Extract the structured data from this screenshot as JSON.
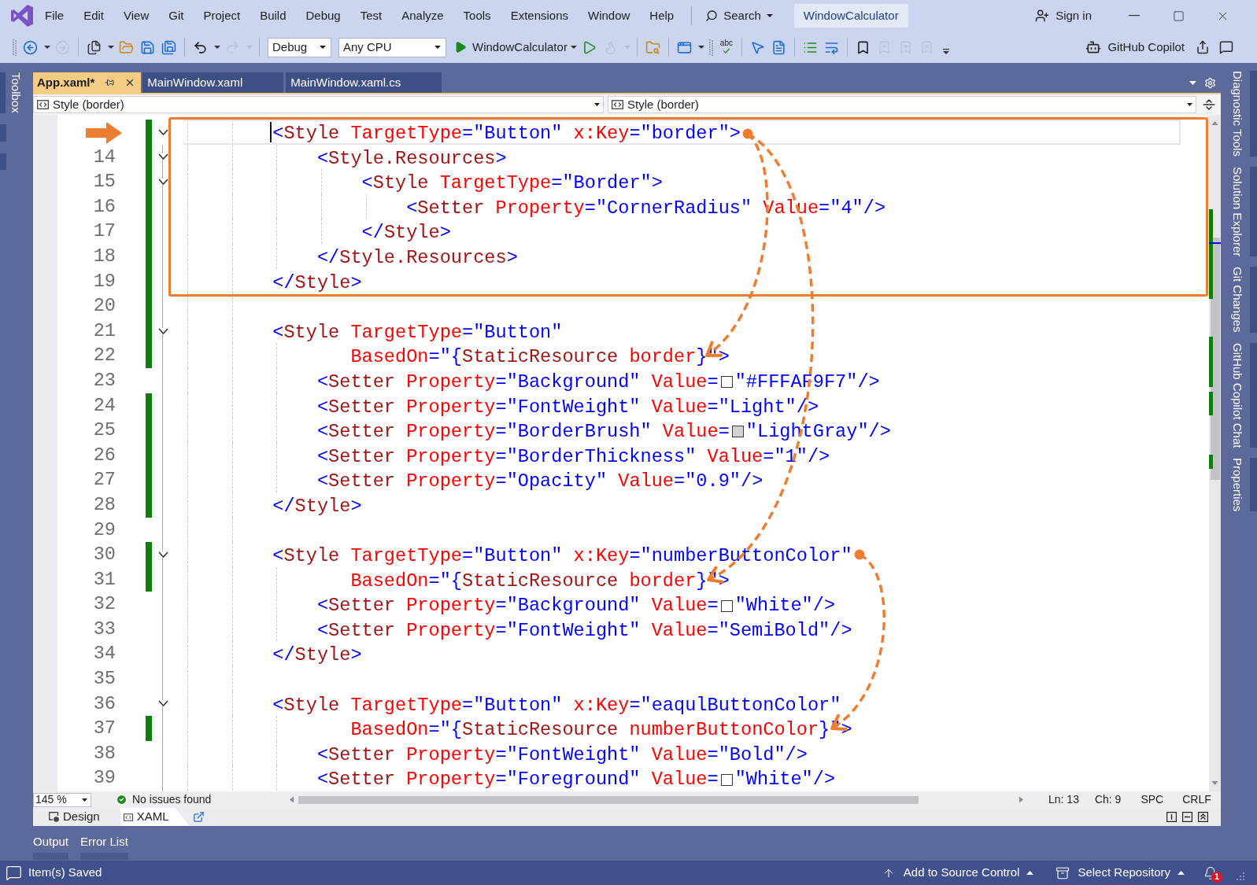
{
  "window": {
    "title": "WindowCalculator"
  },
  "menu": [
    "File",
    "Edit",
    "View",
    "Git",
    "Project",
    "Build",
    "Debug",
    "Test",
    "Analyze",
    "Tools",
    "Extensions",
    "Window",
    "Help"
  ],
  "search": {
    "label": "Search"
  },
  "account": {
    "label": "Sign in"
  },
  "toolbar": {
    "items": [
      {
        "kind": "grip"
      },
      {
        "kind": "back",
        "disabled": false,
        "menu": true
      },
      {
        "kind": "forward",
        "disabled": true
      },
      {
        "kind": "separator"
      },
      {
        "kind": "new_item",
        "disabled": false,
        "menu": true
      },
      {
        "kind": "open",
        "disabled": false
      },
      {
        "kind": "save",
        "disabled": false
      },
      {
        "kind": "save_all",
        "disabled": false
      },
      {
        "kind": "separator"
      },
      {
        "kind": "undo",
        "disabled": false,
        "menu": true
      },
      {
        "kind": "redo",
        "disabled": true,
        "menu": true
      },
      {
        "kind": "separator"
      },
      {
        "kind": "configuration",
        "value": "Debug"
      },
      {
        "kind": "platform",
        "value": "Any CPU"
      },
      {
        "kind": "start",
        "label": "WindowCalculator",
        "menu": true
      },
      {
        "kind": "start_without_debugging",
        "disabled": false
      },
      {
        "kind": "hot_reload",
        "disabled": true,
        "menu": true
      },
      {
        "kind": "separator"
      },
      {
        "kind": "find_in_files",
        "disabled": false
      },
      {
        "kind": "separator"
      },
      {
        "kind": "layout",
        "disabled": false,
        "menu": true
      },
      {
        "kind": "grip"
      },
      {
        "kind": "spell_check",
        "label": "abc",
        "disabled": false
      },
      {
        "kind": "separator"
      },
      {
        "kind": "select",
        "disabled": false
      },
      {
        "kind": "document_outline",
        "disabled": false
      },
      {
        "kind": "separator"
      },
      {
        "kind": "comment",
        "disabled": false
      },
      {
        "kind": "uncomment",
        "disabled": false
      },
      {
        "kind": "separator"
      },
      {
        "kind": "bookmark",
        "disabled": false
      },
      {
        "kind": "bookmark_previous",
        "disabled": true
      },
      {
        "kind": "bookmark_next",
        "disabled": true
      },
      {
        "kind": "bookmark_clear",
        "disabled": true
      },
      {
        "kind": "overflow"
      }
    ],
    "copilot": "GitHub Copilot"
  },
  "left_dock": [
    "Toolbox"
  ],
  "right_dock": [
    "Diagnostic Tools",
    "Solution Explorer",
    "Git Changes",
    "GitHub Copilot Chat",
    "Properties"
  ],
  "tabs": [
    {
      "label": "App.xaml*",
      "selected": true
    },
    {
      "label": "MainWindow.xaml",
      "selected": false
    },
    {
      "label": "MainWindow.xaml.cs",
      "selected": false
    }
  ],
  "nav_bar": [
    "Style (border)",
    "Style (border)"
  ],
  "editor": {
    "lines": [
      {
        "current": true,
        "changed": true,
        "expanded": true,
        "tokens": [
          {
            "kind": "value",
            "text": "<"
          },
          {
            "kind": "tag",
            "text": "Style"
          },
          {
            "kind": "attr",
            "text": " TargetType"
          },
          {
            "kind": "value",
            "text": "=\"Button\""
          },
          {
            "kind": "attr",
            "text": " x:Key"
          },
          {
            "kind": "value",
            "text": "=\"border\">"
          }
        ],
        "children": [
          {
            "number": "14",
            "current": false,
            "changed": true,
            "expanded": true,
            "tokens": [
              {
                "kind": "value",
                "text": "<"
              },
              {
                "kind": "tag",
                "text": "Style.Resources"
              },
              {
                "kind": "value",
                "text": ">"
              }
            ],
            "children": [
              {
                "number": "15",
                "current": false,
                "changed": true,
                "expanded": true,
                "tokens": [
                  {
                    "kind": "value",
                    "text": "<"
                  },
                  {
                    "kind": "tag",
                    "text": "Style"
                  },
                  {
                    "kind": "attr",
                    "text": " TargetType"
                  },
                  {
                    "kind": "value",
                    "text": "=\"Border\">"
                  }
                ],
                "children": [
                  {
                    "number": "16",
                    "current": false,
                    "changed": true,
                    "tokens": [
                      {
                        "kind": "value",
                        "text": "<"
                      },
                      {
                        "kind": "tag",
                        "text": "Setter"
                      },
                      {
                        "kind": "attr",
                        "text": " Property"
                      },
                      {
                        "kind": "value",
                        "text": "=\"CornerRadius\""
                      },
                      {
                        "kind": "attr",
                        "text": " Value"
                      },
                      {
                        "kind": "value",
                        "text": "=\"4\"/>"
                      }
                    ]
                  }
                ]
              },
              {
                "number": "17",
                "current": false,
                "changed": true,
                "tokens": [
                  {
                    "kind": "value",
                    "text": "</"
                  },
                  {
                    "kind": "tag",
                    "text": "Style"
                  },
                  {
                    "kind": "value",
                    "text": ">"
                  }
                ]
              }
            ]
          },
          {
            "number": "18",
            "current": false,
            "changed": true,
            "tokens": [
              {
                "kind": "value",
                "text": "</"
              },
              {
                "kind": "tag",
                "text": "Style.Resources"
              },
              {
                "kind": "value",
                "text": ">"
              }
            ]
          }
        ]
      },
      {
        "number": "19",
        "current": false,
        "changed": true,
        "tokens": [
          {
            "kind": "value",
            "text": "</"
          },
          {
            "kind": "tag",
            "text": "Style"
          },
          {
            "kind": "value",
            "text": ">"
          }
        ]
      },
      {
        "number": "20",
        "current": false,
        "changed": true
      },
      {
        "number": "21",
        "current": false,
        "changed": true,
        "expanded": true,
        "tokens": [
          {
            "kind": "value",
            "text": "<"
          },
          {
            "kind": "tag",
            "text": "Style"
          },
          {
            "kind": "attr",
            "text": " TargetType"
          },
          {
            "kind": "value",
            "text": "=\"Button\""
          }
        ],
        "children": [
          {
            "number": "22",
            "kind": "continuation",
            "current": false,
            "changed": true,
            "tokens": [
              {
                "kind": "attr",
                "text": "BasedOn"
              },
              {
                "kind": "value",
                "text": "=\"{"
              },
              {
                "kind": "tag",
                "text": "StaticResource"
              },
              {
                "kind": "attr",
                "text": " border"
              },
              {
                "kind": "value",
                "text": "}\">"
              }
            ]
          },
          {
            "number": "23",
            "current": false,
            "changed": false,
            "tokens": [
              {
                "kind": "value",
                "text": "<"
              },
              {
                "kind": "tag",
                "text": "Setter"
              },
              {
                "kind": "attr",
                "text": " Property"
              },
              {
                "kind": "value",
                "text": "=\"Background\""
              },
              {
                "kind": "attr",
                "text": " Value"
              },
              {
                "kind": "value",
                "text": "="
              },
              {
                "kind": "swatch",
                "color": "#faf9f7"
              },
              {
                "kind": "value",
                "text": "\"#FFFAF9F7\"/>"
              }
            ]
          },
          {
            "number": "24",
            "current": false,
            "changed": true,
            "tokens": [
              {
                "kind": "value",
                "text": "<"
              },
              {
                "kind": "tag",
                "text": "Setter"
              },
              {
                "kind": "attr",
                "text": " Property"
              },
              {
                "kind": "value",
                "text": "=\"FontWeight\""
              },
              {
                "kind": "attr",
                "text": " Value"
              },
              {
                "kind": "value",
                "text": "=\"Light\"/>"
              }
            ]
          },
          {
            "number": "25",
            "current": false,
            "changed": true,
            "tokens": [
              {
                "kind": "value",
                "text": "<"
              },
              {
                "kind": "tag",
                "text": "Setter"
              },
              {
                "kind": "attr",
                "text": " Property"
              },
              {
                "kind": "value",
                "text": "=\"BorderBrush\""
              },
              {
                "kind": "attr",
                "text": " Value"
              },
              {
                "kind": "value",
                "text": "="
              },
              {
                "kind": "swatch",
                "color": "#d3d3d3"
              },
              {
                "kind": "value",
                "text": "\"LightGray\"/>"
              }
            ]
          },
          {
            "number": "26",
            "current": false,
            "changed": true,
            "tokens": [
              {
                "kind": "value",
                "text": "<"
              },
              {
                "kind": "tag",
                "text": "Setter"
              },
              {
                "kind": "attr",
                "text": " Property"
              },
              {
                "kind": "value",
                "text": "=\"BorderThickness\""
              },
              {
                "kind": "attr",
                "text": " Value"
              },
              {
                "kind": "value",
                "text": "=\"1\"/>"
              }
            ]
          },
          {
            "number": "27",
            "current": false,
            "changed": true,
            "tokens": [
              {
                "kind": "value",
                "text": "<"
              },
              {
                "kind": "tag",
                "text": "Setter"
              },
              {
                "kind": "attr",
                "text": " Property"
              },
              {
                "kind": "value",
                "text": "=\"Opacity\""
              },
              {
                "kind": "attr",
                "text": " Value"
              },
              {
                "kind": "value",
                "text": "=\"0.9\"/>"
              }
            ]
          }
        ]
      },
      {
        "number": "28",
        "current": false,
        "changed": true,
        "tokens": [
          {
            "kind": "value",
            "text": "</"
          },
          {
            "kind": "tag",
            "text": "Style"
          },
          {
            "kind": "value",
            "text": ">"
          }
        ]
      },
      {
        "number": "29",
        "current": false,
        "changed": false
      },
      {
        "number": "30",
        "current": false,
        "changed": true,
        "expanded": true,
        "tokens": [
          {
            "kind": "value",
            "text": "<"
          },
          {
            "kind": "tag",
            "text": "Style"
          },
          {
            "kind": "attr",
            "text": " TargetType"
          },
          {
            "kind": "value",
            "text": "=\"Button\""
          },
          {
            "kind": "attr",
            "text": " x:Key"
          },
          {
            "kind": "value",
            "text": "=\"numberButtonColor\""
          }
        ],
        "children": [
          {
            "number": "31",
            "kind": "continuation",
            "current": false,
            "changed": true,
            "tokens": [
              {
                "kind": "attr",
                "text": "BasedOn"
              },
              {
                "kind": "value",
                "text": "=\"{"
              },
              {
                "kind": "tag",
                "text": "StaticResource"
              },
              {
                "kind": "attr",
                "text": " border"
              },
              {
                "kind": "value",
                "text": "}\">"
              }
            ]
          },
          {
            "number": "32",
            "current": false,
            "changed": false,
            "tokens": [
              {
                "kind": "value",
                "text": "<"
              },
              {
                "kind": "tag",
                "text": "Setter"
              },
              {
                "kind": "attr",
                "text": " Property"
              },
              {
                "kind": "value",
                "text": "=\"Background\""
              },
              {
                "kind": "attr",
                "text": " Value"
              },
              {
                "kind": "value",
                "text": "="
              },
              {
                "kind": "swatch",
                "color": "#ffffff"
              },
              {
                "kind": "value",
                "text": "\"White\"/>"
              }
            ]
          },
          {
            "number": "33",
            "current": false,
            "changed": false,
            "tokens": [
              {
                "kind": "value",
                "text": "<"
              },
              {
                "kind": "tag",
                "text": "Setter"
              },
              {
                "kind": "attr",
                "text": " Property"
              },
              {
                "kind": "value",
                "text": "=\"FontWeight\""
              },
              {
                "kind": "attr",
                "text": " Value"
              },
              {
                "kind": "value",
                "text": "=\"SemiBold\"/>"
              }
            ]
          }
        ]
      },
      {
        "number": "34",
        "current": false,
        "changed": false,
        "tokens": [
          {
            "kind": "value",
            "text": "</"
          },
          {
            "kind": "tag",
            "text": "Style"
          },
          {
            "kind": "value",
            "text": ">"
          }
        ]
      },
      {
        "number": "35",
        "current": false,
        "changed": false
      },
      {
        "number": "36",
        "current": false,
        "changed": false,
        "expanded": true,
        "tokens": [
          {
            "kind": "value",
            "text": "<"
          },
          {
            "kind": "tag",
            "text": "Style"
          },
          {
            "kind": "attr",
            "text": " TargetType"
          },
          {
            "kind": "value",
            "text": "=\"Button\""
          },
          {
            "kind": "attr",
            "text": " x:Key"
          },
          {
            "kind": "value",
            "text": "=\"eaqulButtonColor\""
          }
        ],
        "children": [
          {
            "number": "37",
            "kind": "continuation",
            "current": false,
            "changed": true,
            "tokens": [
              {
                "kind": "attr",
                "text": "BasedOn"
              },
              {
                "kind": "value",
                "text": "=\"{"
              },
              {
                "kind": "tag",
                "text": "StaticResource"
              },
              {
                "kind": "attr",
                "text": " numberButtonColor"
              },
              {
                "kind": "value",
                "text": "}\">"
              }
            ]
          },
          {
            "number": "38",
            "current": false,
            "changed": false,
            "tokens": [
              {
                "kind": "value",
                "text": "<"
              },
              {
                "kind": "tag",
                "text": "Setter"
              },
              {
                "kind": "attr",
                "text": " Property"
              },
              {
                "kind": "value",
                "text": "=\"FontWeight\""
              },
              {
                "kind": "attr",
                "text": " Value"
              },
              {
                "kind": "value",
                "text": "=\"Bold\"/>"
              }
            ]
          },
          {
            "number": "39",
            "current": false,
            "changed": false,
            "tokens": [
              {
                "kind": "value",
                "text": "<"
              },
              {
                "kind": "tag",
                "text": "Setter"
              },
              {
                "kind": "attr",
                "text": " Property"
              },
              {
                "kind": "value",
                "text": "=\"Foreground\""
              },
              {
                "kind": "attr",
                "text": " Value"
              },
              {
                "kind": "value",
                "text": "="
              },
              {
                "kind": "swatch",
                "color": "#ffffff"
              },
              {
                "kind": "value",
                "text": "\"White\"/>"
              }
            ]
          }
        ]
      }
    ]
  },
  "editor_status": {
    "zoom": "145 %",
    "issues": "No issues found",
    "line": "Ln: 13",
    "column": "Ch: 9",
    "indentation": "SPC",
    "line_endings": "CRLF"
  },
  "view_tabs": [
    {
      "kind": "design",
      "label": "Design",
      "selected": false
    },
    {
      "kind": "xaml",
      "label": "XAML",
      "selected": true
    }
  ],
  "bottom_dock": [
    "Output",
    "Error List"
  ],
  "status_bar": {
    "message": "Item(s) Saved",
    "source_control": "Add to Source Control",
    "repository": "Select Repository",
    "notification_count": "1"
  }
}
